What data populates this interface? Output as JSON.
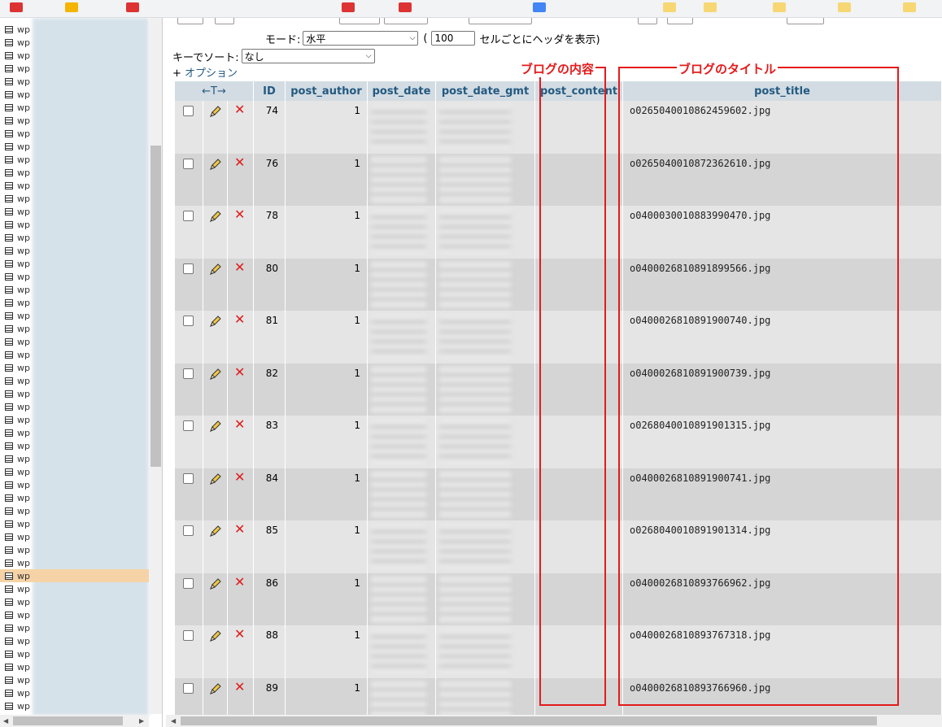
{
  "nav": {
    "item_label": "wp",
    "items_count_visible": 54
  },
  "controls": {
    "mode_label": "モード:",
    "mode_value": "水平",
    "header_paren_open": "(",
    "header_every_value": "100",
    "header_every_suffix": "セルごとにヘッダを表示)",
    "sort_label": "キーでソート:",
    "sort_value": "なし",
    "options_prefix": "+",
    "options_link": "オプション"
  },
  "table": {
    "columns": {
      "arrows": "←T→",
      "id": "ID",
      "post_author": "post_author",
      "post_date": "post_date",
      "post_date_gmt": "post_date_gmt",
      "post_content": "post_content",
      "post_title": "post_title"
    },
    "rows": [
      {
        "id": "74",
        "author": "1",
        "title": "o0265040010862459602.jpg"
      },
      {
        "id": "76",
        "author": "1",
        "title": "o0265040010872362610.jpg"
      },
      {
        "id": "78",
        "author": "1",
        "title": "o0400030010883990470.jpg"
      },
      {
        "id": "80",
        "author": "1",
        "title": "o0400026810891899566.jpg"
      },
      {
        "id": "81",
        "author": "1",
        "title": "o0400026810891900740.jpg"
      },
      {
        "id": "82",
        "author": "1",
        "title": "o0400026810891900739.jpg"
      },
      {
        "id": "83",
        "author": "1",
        "title": "o0268040010891901315.jpg"
      },
      {
        "id": "84",
        "author": "1",
        "title": "o0400026810891900741.jpg"
      },
      {
        "id": "85",
        "author": "1",
        "title": "o0268040010891901314.jpg"
      },
      {
        "id": "86",
        "author": "1",
        "title": "o0400026810893766962.jpg"
      },
      {
        "id": "88",
        "author": "1",
        "title": "o0400026810893767318.jpg"
      },
      {
        "id": "89",
        "author": "1",
        "title": "o0400026810893766960.jpg"
      }
    ]
  },
  "annotations": {
    "content_label": "ブログの内容",
    "title_label": "ブログのタイトル",
    "color": "#e31b1b"
  },
  "colors": {
    "link": "#235a81",
    "header_bg": "#d3dce3",
    "row_odd": "#e5e5e5",
    "row_even": "#d5d5d5",
    "active_nav": "#f6d3a6",
    "delete": "#e01b1b"
  }
}
